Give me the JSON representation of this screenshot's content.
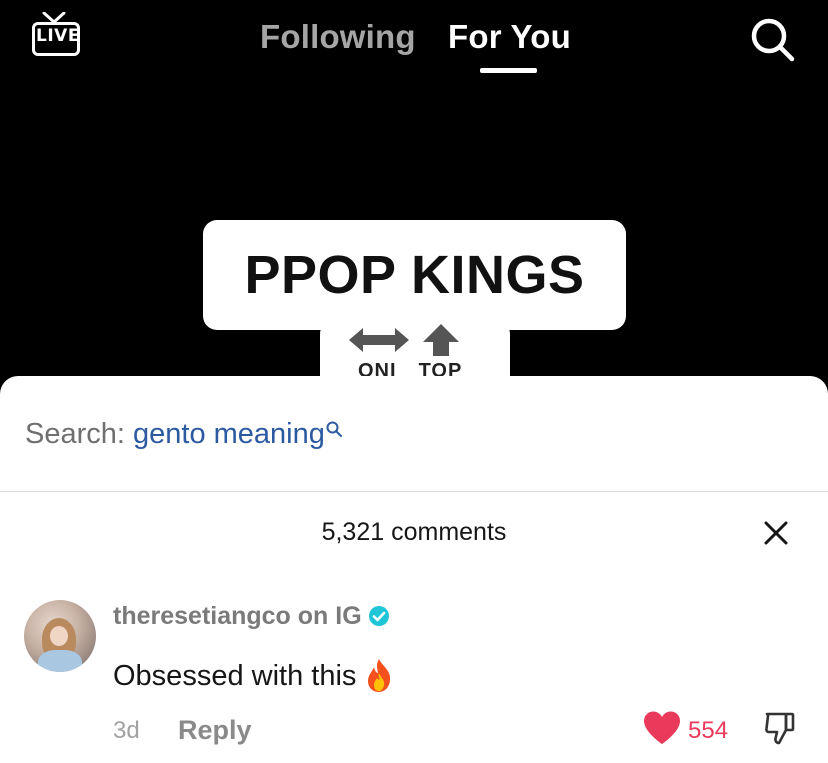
{
  "header": {
    "live_label": "LIVE",
    "tabs": [
      {
        "label": "Following",
        "active": false
      },
      {
        "label": "For You",
        "active": true
      }
    ],
    "search_icon": "search-icon"
  },
  "video": {
    "sign_text": "PPOP KINGS",
    "sign_subtext": [
      "ONI",
      "TOP"
    ]
  },
  "comments_sheet": {
    "search": {
      "prefix": "Search:",
      "term": "gento meaning"
    },
    "count_label": "5,321 comments",
    "comments": [
      {
        "username": "theresetiangco on IG",
        "verified": true,
        "text": "Obsessed with this",
        "emoji": "fire-icon",
        "time": "3d",
        "reply_label": "Reply",
        "likes": "554",
        "liked": true
      }
    ]
  },
  "colors": {
    "accent_like": "#ea3a5b",
    "search_link": "#2c5aa0",
    "verified": "#20c5d8"
  }
}
